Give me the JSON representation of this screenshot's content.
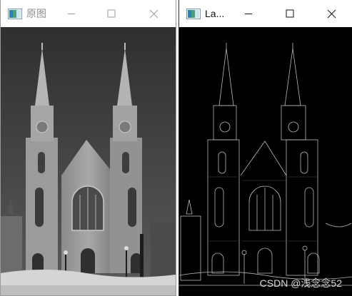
{
  "windows": [
    {
      "title": "原图",
      "icon": "opencv-window-icon",
      "controls": [
        "minimize-icon",
        "maximize-icon",
        "close-icon"
      ],
      "content": "grayscale photograph of a church with twin spires"
    },
    {
      "title": "La...",
      "icon": "opencv-window-icon",
      "controls": [
        "minimize-icon",
        "maximize-icon",
        "close-icon"
      ],
      "content": "laplacian edge detection result of the same church"
    }
  ],
  "watermark": "CSDN @浅念念52",
  "colors": {
    "titlebar_bg": "#ffffff",
    "inactive_title_text": "#8e8e8e",
    "active_title_text": "#111111",
    "edge_image_bg": "#000000"
  }
}
